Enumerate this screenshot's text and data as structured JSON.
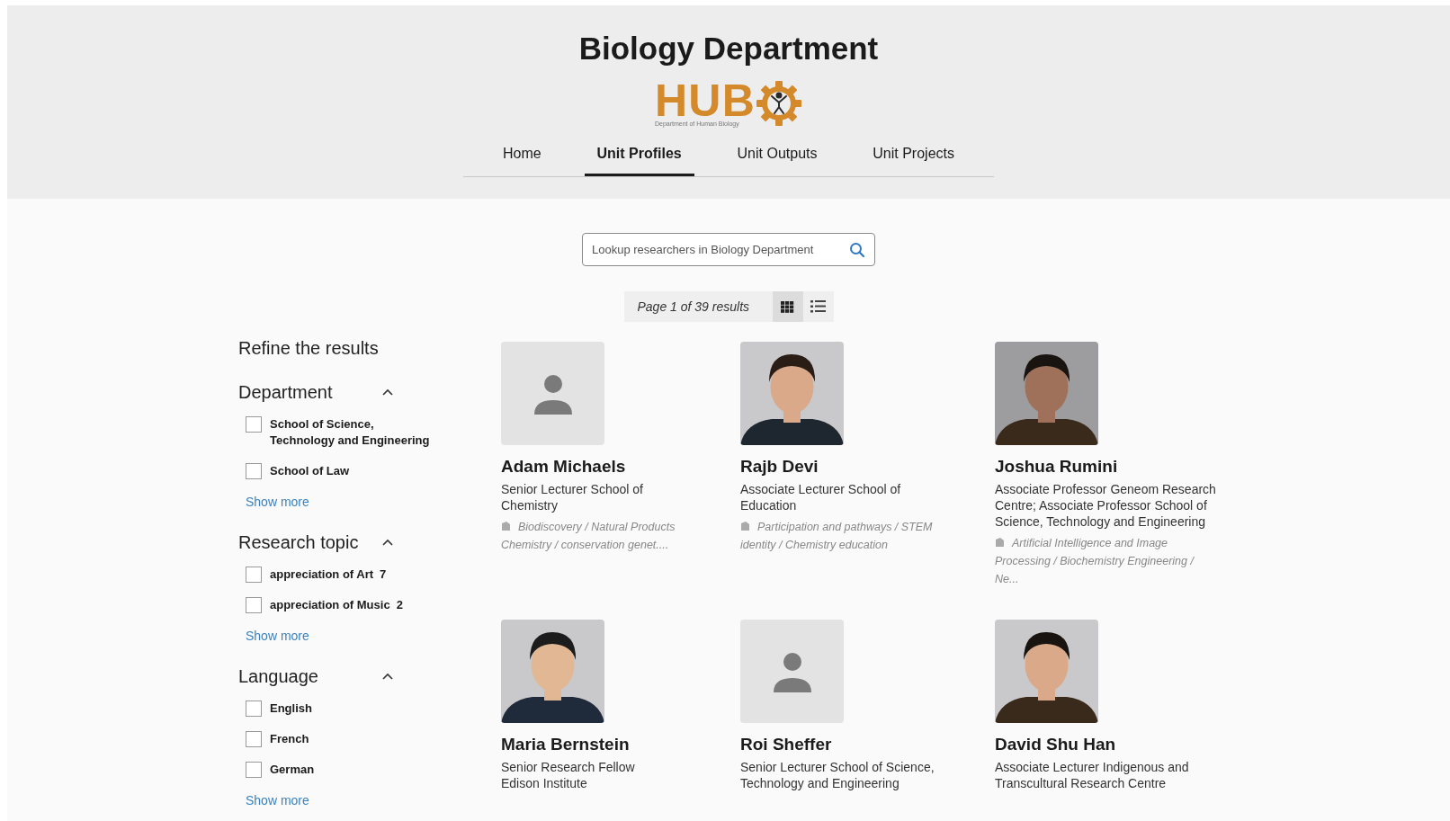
{
  "header": {
    "title": "Biology Department",
    "logo": {
      "wordmark": "HUB",
      "subtitle": "Department of Human Biology"
    }
  },
  "tabs": [
    {
      "label": "Home",
      "selected": false
    },
    {
      "label": "Unit Profiles",
      "selected": true
    },
    {
      "label": "Unit Outputs",
      "selected": false
    },
    {
      "label": "Unit Projects",
      "selected": false
    }
  ],
  "search": {
    "placeholder": "Lookup researchers in Biology Department"
  },
  "results": {
    "summary": "Page 1 of 39 results",
    "views": [
      {
        "kind": "grid",
        "selected": true
      },
      {
        "kind": "list",
        "selected": false
      }
    ]
  },
  "filters": {
    "title": "Refine the results",
    "groups": [
      {
        "title": "Department",
        "expanded": true,
        "options": [
          {
            "label": "School of Science, Technology and Engineering",
            "checked": false
          },
          {
            "label": "School of Law",
            "checked": false
          }
        ],
        "more": "Show more"
      },
      {
        "title": "Research topic",
        "expanded": true,
        "options": [
          {
            "label": "appreciation of Art",
            "count": "7",
            "checked": false
          },
          {
            "label": "appreciation of Music",
            "count": "2",
            "checked": false
          }
        ],
        "more": "Show more"
      },
      {
        "title": "Language",
        "expanded": true,
        "options": [
          {
            "label": "English",
            "checked": false
          },
          {
            "label": "French",
            "checked": false
          },
          {
            "label": "German",
            "checked": false
          }
        ],
        "more": "Show more"
      }
    ]
  },
  "profiles": [
    {
      "name": "Adam Michaels",
      "role": "Senior Lecturer School of Chemistry",
      "topics": "Biodiscovery  /  Natural Products Chemistry  /  conservation genet....",
      "avatar": {
        "kind": "placeholder"
      }
    },
    {
      "name": "Rajb Devi",
      "role": "Associate Lecturer School of Education",
      "topics": "Participation and pathways / STEM identity / Chemistry education"
    },
    {
      "name": "Joshua Rumini",
      "role": "Associate Professor Geneom Research Centre; Associate Professor School of Science, Technology and Engineering",
      "topics": "Artificial Intelligence and Image Processing / Biochemistry Engineering  /  Ne..."
    },
    {
      "name": "Maria Bernstein",
      "role": "Senior Research Fellow Edison Institute"
    },
    {
      "name": "Roi Sheffer",
      "role": "Senior Lecturer School of Science, Technology and Engineering",
      "avatar": {
        "kind": "placeholder"
      }
    },
    {
      "name": "David Shu Han",
      "role": "Associate Lecturer Indigenous and Transcultural Research Centre"
    }
  ]
}
